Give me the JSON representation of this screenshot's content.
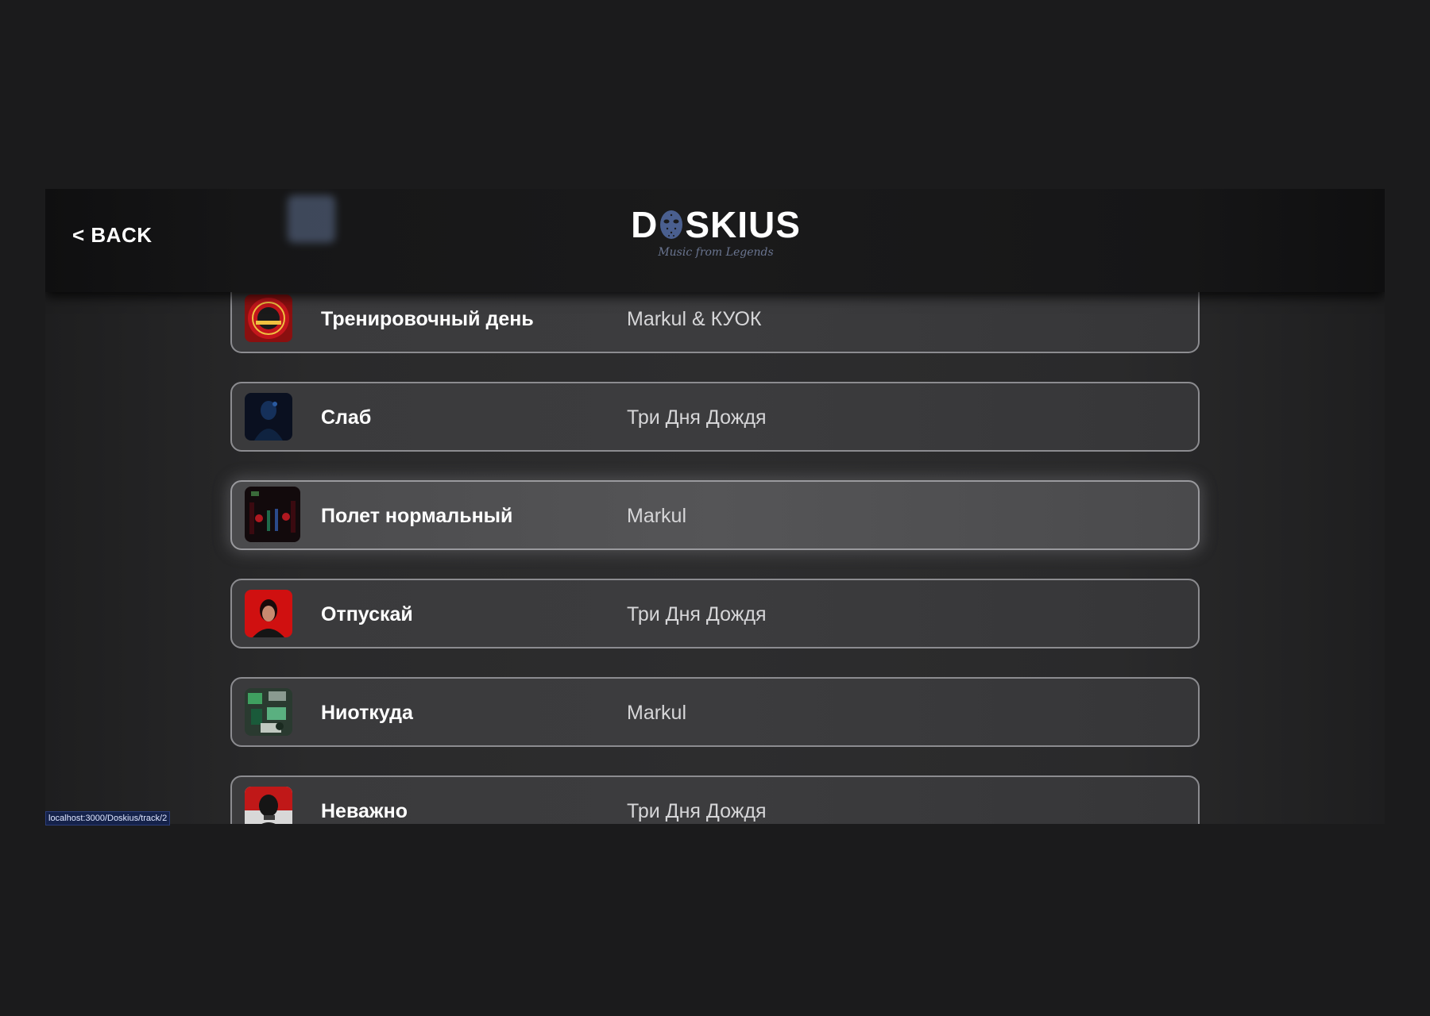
{
  "header": {
    "back_label": "< BACK",
    "logo": {
      "text_left": "D",
      "text_right": "SKIUS",
      "tagline": "Music from Legends"
    }
  },
  "tracks": [
    {
      "title": "Тренировочный день",
      "artist": "Markul & КУОК",
      "cover_icon": "album-cover-red-emblem",
      "active": false
    },
    {
      "title": "Слаб",
      "artist": "Три Дня Дождя",
      "cover_icon": "album-cover-dark-blue",
      "active": false
    },
    {
      "title": "Полет нормальный",
      "artist": "Markul",
      "cover_icon": "album-cover-dark-neon",
      "active": true
    },
    {
      "title": "Отпускай",
      "artist": "Три Дня Дождя",
      "cover_icon": "album-cover-red-portrait",
      "active": false
    },
    {
      "title": "Ниоткуда",
      "artist": "Markul",
      "cover_icon": "album-cover-green-collage",
      "active": false
    },
    {
      "title": "Неважно",
      "artist": "Три Дня Дождя",
      "cover_icon": "album-cover-red-dark-portrait",
      "active": false
    }
  ],
  "status_bar": {
    "url": "localhost:3000/Doskius/track/2"
  },
  "colors": {
    "background": "#1b1b1c",
    "row_border": "#8c8c90",
    "tagline": "#6a7590",
    "status_bg": "#15224a"
  }
}
